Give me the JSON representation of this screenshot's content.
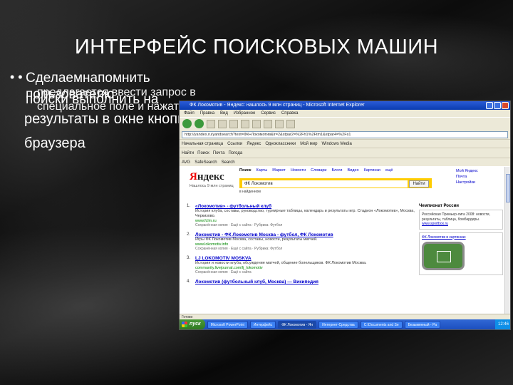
{
  "slide": {
    "title": "ИНТЕРФЕЙС ПОИСКОВЫХ МАШИН",
    "bullets": {
      "dot": "• •",
      "line1": "Сделаемнапомнить пользователю",
      "line1b": "поиски выполнить на",
      "line2": "предлагается ввести запрос в специальное поле и нажать",
      "line3": "результаты в окне кнопке",
      "line4": "браузера"
    }
  },
  "browser": {
    "title": "ФК Локомотив - Яндекс: нашлось 9 млн страниц - Microsoft Internet Explorer",
    "menu": [
      "Файл",
      "Правка",
      "Вид",
      "Избранное",
      "Сервис",
      "Справка"
    ],
    "address": "http://yandex.ru/yandsearch?text=ФК+Локомотив&lr=2&stpar2=%2Fh1%2Ftm1&stpar4=%2Fs1",
    "links": [
      "Начальная страница",
      "Ссылки",
      "Яндекс",
      "Одноклассники",
      "Мой мир",
      "Windows Media"
    ],
    "toolbar2": [
      "Найти",
      "Поиск",
      "Почта",
      "Погода"
    ],
    "toolbar3": [
      "AVG",
      "SafeSearch",
      "Search"
    ],
    "status": "Готово"
  },
  "yandex": {
    "logo_first": "Я",
    "logo_rest": "ндекс",
    "sub": "Нашлось 9 млн страниц",
    "nav": [
      "Поиск",
      "Карты",
      "Маркет",
      "Новости",
      "Словари",
      "Блоги",
      "Видео",
      "Картинки",
      "ещё"
    ],
    "query": "ФК Локомотив",
    "search_button": "Найти",
    "check_label": "в найденном",
    "right_top": [
      "Мой Яндекс",
      "Почта",
      "Настройки"
    ],
    "results": [
      {
        "num": "1.",
        "title": "«Локомотив» - футбольный клуб",
        "snippet": "История клуба, составы, руководство, турнирные таблицы, календарь и результаты игр. Стадион «Локомотив», Москва, Черкизово.",
        "url": "www.fclm.ru",
        "meta": "Сохранённая копия · Ещё с сайта · Рубрика: Футбол"
      },
      {
        "num": "2.",
        "title": "Локомотив - ФК Локомотив Москва - футбол, ФК Локомотив",
        "snippet": "Игры ФК Локомотив Москва, составы, новости, результаты матчей.",
        "url": "www.lokomotiv.info",
        "meta": "Сохранённая копия · Ещё с сайта · Рубрика: Футбол"
      },
      {
        "num": "3.",
        "title": "LJ LOKOMOTIV MOSKVA",
        "snippet": "История и новости клуба, обсуждение матчей, общение болельщиков. ФК Локомотив Москва.",
        "url": "community.livejournal.com/lj_lokomotiv",
        "meta": "Сохранённая копия · Ещё с сайта"
      },
      {
        "num": "4.",
        "title": "Локомотив (футбольный клуб, Москва) — Википедия",
        "snippet": "",
        "url": "",
        "meta": ""
      }
    ],
    "sidebar": {
      "head": "Чемпионат России",
      "text": "Российская Премьер-лига 2008: новости, результаты, таблица, бомбардиры.",
      "link": "www.sportbox.ru",
      "caption": "ФК Локомотив в картинках"
    }
  },
  "taskbar": {
    "start": "пуск",
    "tasks": [
      "Microsoft PowerPoint",
      "Интерфейс",
      "ФК Локомотив - Ян",
      "Интернет-Средства",
      "C:\\Documents and Se",
      "Безымянный - Pa"
    ],
    "clock": "12:46"
  }
}
